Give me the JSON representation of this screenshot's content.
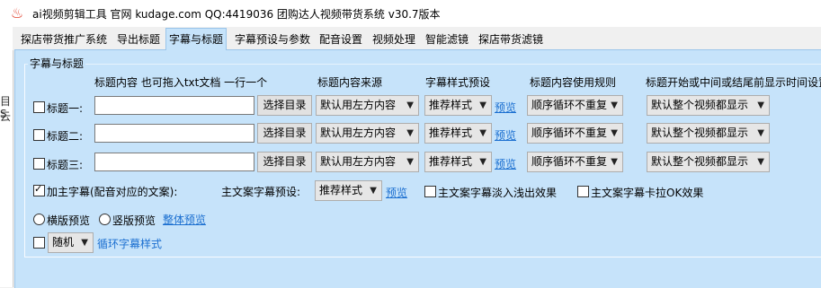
{
  "window": {
    "title": "ai视频剪辑工具 官网 kudage.com QQ:4419036     团购达人视频带货系统    v30.7版本",
    "icon": "flame-icon"
  },
  "left_fragments": [
    "目云",
    "S"
  ],
  "tabs": [
    {
      "label": "探店带货推广系统"
    },
    {
      "label": "导出标题"
    },
    {
      "label": "字幕与标题"
    },
    {
      "label": "字幕预设与参数"
    },
    {
      "label": "配音设置"
    },
    {
      "label": "视频处理"
    },
    {
      "label": "智能滤镜"
    },
    {
      "label": "探店带货滤镜"
    }
  ],
  "group": {
    "title": "字幕与标题",
    "headers": {
      "content": "标题内容 也可拖入txt文档 一行一个",
      "source": "标题内容来源",
      "style": "字幕样式预设",
      "rule": "标题内容使用规则",
      "timing": "标题开始或中间或结尾前显示时间设置"
    },
    "rows": [
      {
        "label": "标题一:",
        "checked": false,
        "value": "",
        "choose_button": "选择目录",
        "source": "默认用左方内容",
        "style": "推荐样式",
        "preview": "预览",
        "rule": "顺序循环不重复",
        "timing": "默认整个视频都显示"
      },
      {
        "label": "标题二:",
        "checked": false,
        "value": "",
        "choose_button": "选择目录",
        "source": "默认用左方内容",
        "style": "推荐样式",
        "preview": "预览",
        "rule": "顺序循环不重复",
        "timing": "默认整个视频都显示"
      },
      {
        "label": "标题三:",
        "checked": false,
        "value": "",
        "choose_button": "选择目录",
        "source": "默认用左方内容",
        "style": "推荐样式",
        "preview": "预览",
        "rule": "顺序循环不重复",
        "timing": "默认整个视频都显示"
      }
    ],
    "main_subtitle": {
      "checkbox_label": "加主字幕(配音对应的文案):",
      "checked": true,
      "preset_label": "主文案字幕预设:",
      "preset_value": "推荐样式",
      "preview": "预览",
      "fade_label": "主文案字幕淡入浅出效果",
      "fade_checked": false,
      "karaoke_label": "主文案字幕卡拉OK效果",
      "karaoke_checked": false
    },
    "preview_options": {
      "horizontal": "横版预览",
      "vertical": "竖版预览",
      "overall": "整体预览"
    },
    "cycle": {
      "checked": false,
      "mode": "随机",
      "label": "循环字幕样式"
    }
  }
}
